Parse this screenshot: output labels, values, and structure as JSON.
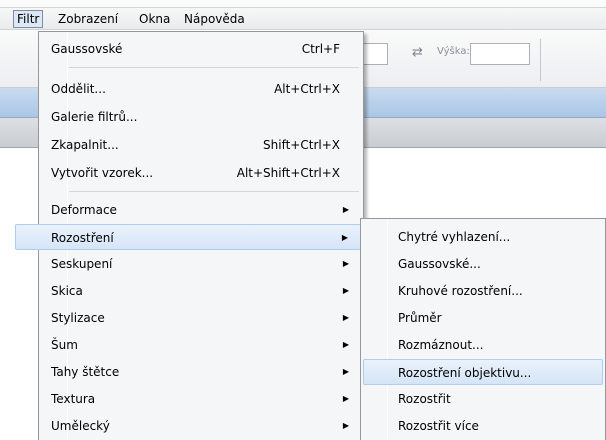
{
  "menubar": {
    "items": [
      "Filtr",
      "Zobrazení",
      "Okna",
      "Nápověda"
    ],
    "active_index": 0
  },
  "options_bar": {
    "height_label": "Výška:"
  },
  "filter_menu": {
    "items": [
      {
        "label": "Gaussovské",
        "shortcut": "Ctrl+F"
      },
      {
        "label": "Oddělit...",
        "shortcut": "Alt+Ctrl+X"
      },
      {
        "label": "Galerie filtrů...",
        "shortcut": ""
      },
      {
        "label": "Zkapalnit...",
        "shortcut": "Shift+Ctrl+X"
      },
      {
        "label": "Vytvořit vzorek...",
        "shortcut": "Alt+Shift+Ctrl+X"
      },
      {
        "label": "Deformace",
        "submenu": true
      },
      {
        "label": "Rozostření",
        "submenu": true,
        "highlighted": true
      },
      {
        "label": "Seskupení",
        "submenu": true
      },
      {
        "label": "Skica",
        "submenu": true
      },
      {
        "label": "Stylizace",
        "submenu": true
      },
      {
        "label": "Šum",
        "submenu": true
      },
      {
        "label": "Tahy štětce",
        "submenu": true
      },
      {
        "label": "Textura",
        "submenu": true
      },
      {
        "label": "Umělecký",
        "submenu": true
      }
    ]
  },
  "blur_submenu": {
    "items": [
      {
        "label": "Chytré vyhlazení..."
      },
      {
        "label": "Gaussovské..."
      },
      {
        "label": "Kruhové rozostření..."
      },
      {
        "label": "Průměr"
      },
      {
        "label": "Rozmáznout..."
      },
      {
        "label": "Rozostření objektivu...",
        "highlighted": true
      },
      {
        "label": "Rozostřit"
      },
      {
        "label": "Rozostřit více"
      }
    ]
  },
  "icons": {
    "submenu_arrow": "triangle-right-icon",
    "swap": "swap-arrows-icon"
  },
  "colors": {
    "menu_bg": "#f5f6f7",
    "highlight_bg": "#d5e5f7",
    "highlight_border": "#aecbf0",
    "titlebar": "#aac6e6"
  }
}
